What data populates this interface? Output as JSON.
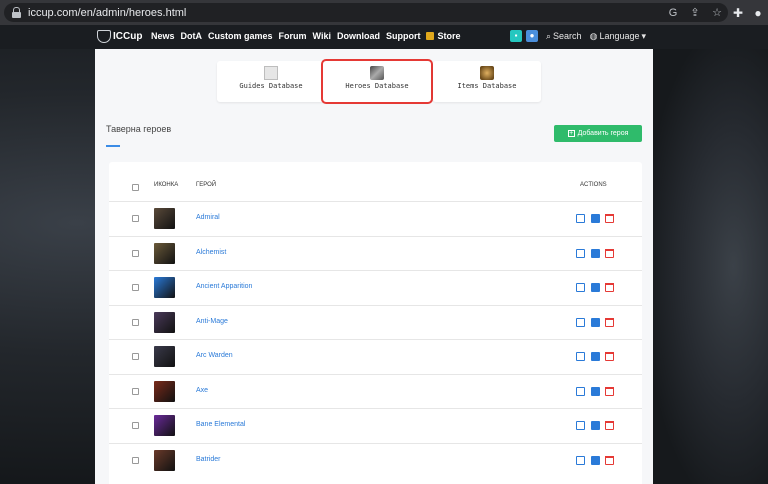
{
  "browser": {
    "url": "iccup.com/en/admin/heroes.html",
    "url_icons": [
      "google-search-icon",
      "share-icon",
      "bookmark-star-icon"
    ],
    "toolbar_icons": [
      "extensions-puzzle-icon",
      "profile-icon"
    ]
  },
  "header": {
    "logo_text": "ICCup",
    "nav": [
      "News",
      "DotA",
      "Custom games",
      "Forum",
      "Wiki",
      "Download",
      "Support"
    ],
    "store_label": "Store",
    "search_label": "Search",
    "language_label": "Language"
  },
  "databases": [
    {
      "label": "Guides Database",
      "icon": "document-icon",
      "selected": false
    },
    {
      "label": "Heroes Database",
      "icon": "hero-portrait-icon",
      "selected": true
    },
    {
      "label": "Items Database",
      "icon": "item-icon",
      "selected": false
    }
  ],
  "page": {
    "section_title": "Таверна героев",
    "add_button": "Добавить героя"
  },
  "table": {
    "col_icon": "ИКОНКА",
    "col_hero": "ГЕРОЙ",
    "col_actions": "ACTIONS",
    "rows": [
      {
        "name": "Admiral",
        "color": "#5a4a3a"
      },
      {
        "name": "Alchemist",
        "color": "#6b5a3a"
      },
      {
        "name": "Ancient Apparition",
        "color": "#2a7ad8"
      },
      {
        "name": "Anti-Mage",
        "color": "#4a3a5a"
      },
      {
        "name": "Arc Warden",
        "color": "#3a3a4a"
      },
      {
        "name": "Axe",
        "color": "#7a2a1a"
      },
      {
        "name": "Bane Elemental",
        "color": "#6a2a9a"
      },
      {
        "name": "Batrider",
        "color": "#6a3a2a"
      }
    ]
  },
  "colors": {
    "accent_blue": "#2a7ad8",
    "success_green": "#2fbb6b",
    "danger_red": "#e53935",
    "highlight_border": "#e53935"
  }
}
